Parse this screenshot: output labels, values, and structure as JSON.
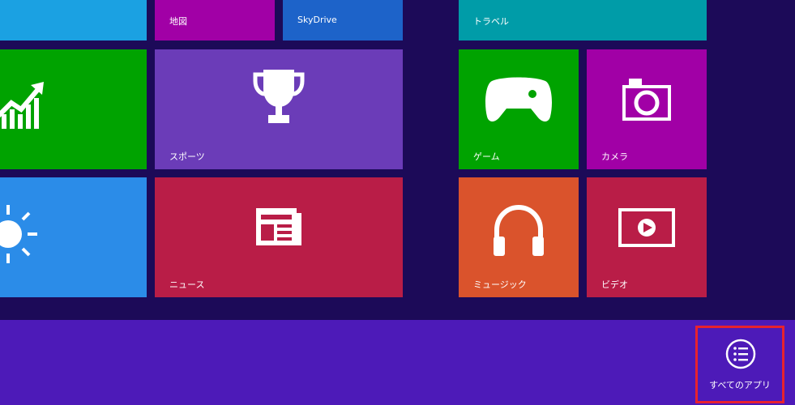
{
  "tiles": {
    "partial_top": {
      "label": "",
      "color": "#1ba1e2"
    },
    "map": {
      "label": "地図",
      "color": "#a100a6"
    },
    "skydrive": {
      "label": "SkyDrive",
      "color": "#1d63c9"
    },
    "travel": {
      "label": "トラベル",
      "color": "#009ca8"
    },
    "finance": {
      "label": "",
      "color": "#00a300"
    },
    "sports": {
      "label": "スポーツ",
      "color": "#6b3cb8"
    },
    "weather": {
      "label": "",
      "color": "#2b8ce8"
    },
    "news": {
      "label": "ニュース",
      "color": "#b91d47"
    },
    "games": {
      "label": "ゲーム",
      "color": "#00a300"
    },
    "camera": {
      "label": "カメラ",
      "color": "#a100a6"
    },
    "music": {
      "label": "ミュージック",
      "color": "#da532c"
    },
    "video": {
      "label": "ビデオ",
      "color": "#b91d47"
    }
  },
  "app_bar": {
    "all_apps_label": "すべてのアプリ",
    "highlight_color": "#e8222e"
  }
}
